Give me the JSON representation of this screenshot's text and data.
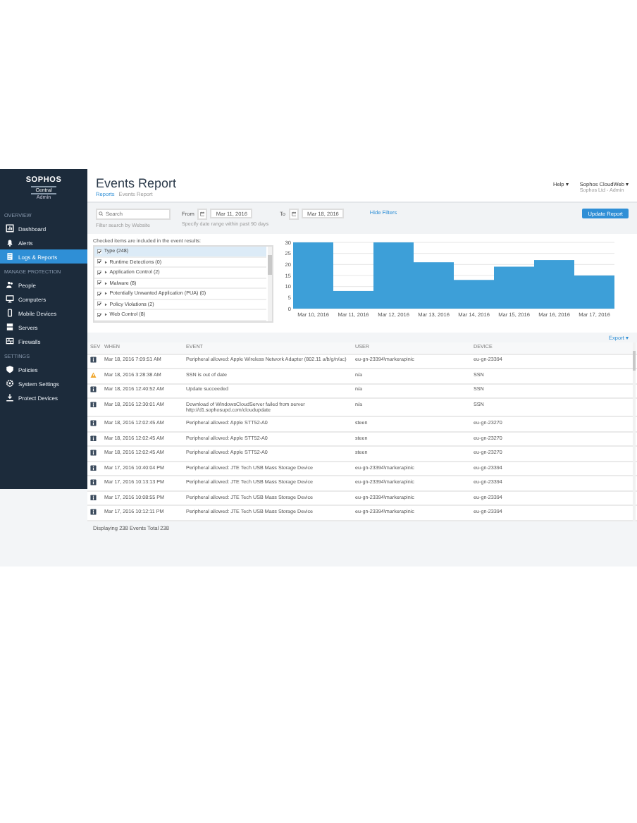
{
  "sidebar": {
    "logo": "SOPHOS",
    "logo_sub": "Central",
    "logo_role": "Admin",
    "sections": [
      {
        "heading": "OVERVIEW",
        "items": [
          {
            "label": "Dashboard",
            "selected": false
          },
          {
            "label": "Alerts",
            "selected": false
          },
          {
            "label": "Logs & Reports",
            "selected": true
          }
        ]
      },
      {
        "heading": "MANAGE PROTECTION",
        "items": [
          {
            "label": "People",
            "selected": false
          },
          {
            "label": "Computers",
            "selected": false
          },
          {
            "label": "Mobile Devices",
            "selected": false
          },
          {
            "label": "Servers",
            "selected": false
          },
          {
            "label": "Firewalls",
            "selected": false
          }
        ]
      },
      {
        "heading": "SETTINGS",
        "items": [
          {
            "label": "Policies",
            "selected": false
          },
          {
            "label": "System Settings",
            "selected": false
          },
          {
            "label": "Protect Devices",
            "selected": false
          }
        ]
      }
    ]
  },
  "header": {
    "title": "Events Report",
    "breadcrumb": [
      "Reports",
      "Events Report"
    ],
    "help": "Help ▾",
    "account": "Sophos CloudWeb ▾",
    "account_sub": "Sophos Ltd - Admin"
  },
  "filters": {
    "search": {
      "placeholder": "Search"
    },
    "search_hint": "Filter search by Website",
    "from_label": "From",
    "from_date": "Mar 11, 2016",
    "range_hint": "Specify date range within past 90 days",
    "to_label": "To",
    "to_date": "Mar 18, 2016",
    "hide": "Hide Filters",
    "update": "Update Report"
  },
  "event_types": {
    "caption": "Checked items are included in the event results:",
    "items": [
      {
        "label": "Type (248)",
        "checked": true,
        "selected": true
      },
      {
        "label": "Runtime Detections (0)",
        "checked": true,
        "selected": false
      },
      {
        "label": "Application Control (2)",
        "checked": true,
        "selected": false
      },
      {
        "label": "Malware (8)",
        "checked": true,
        "selected": false
      },
      {
        "label": "Potentially Unwanted Application (PUA) (0)",
        "checked": true,
        "selected": false
      },
      {
        "label": "Policy Violations (2)",
        "checked": true,
        "selected": false
      },
      {
        "label": "Web Control (8)",
        "checked": true,
        "selected": false
      }
    ]
  },
  "chart_data": {
    "type": "bar",
    "categories": [
      "Mar 10, 2016",
      "Mar 11, 2016",
      "Mar 12, 2016",
      "Mar 13, 2016",
      "Mar 14, 2016",
      "Mar 15, 2016",
      "Mar 16, 2016",
      "Mar 17, 2016"
    ],
    "series": [
      {
        "color": "#3d9fd8",
        "values": [
          30,
          8,
          30,
          21,
          13,
          19,
          22,
          15
        ]
      }
    ],
    "ylim": [
      0,
      30
    ],
    "yticks": [
      0,
      5,
      10,
      15,
      20,
      25,
      30
    ],
    "grid": true
  },
  "export": "Export ▾",
  "table": {
    "columns": [
      "SEV",
      "WHEN",
      "EVENT",
      "USER",
      "DEVICE"
    ],
    "rows": [
      {
        "kind": "info",
        "when": "Mar 18, 2016 7:09:51 AM",
        "event": "Peripheral allowed: Apple Wireless Network Adapter (802.11 a/b/g/n/ac)",
        "user": "eu-gn-23394\\markerapinic",
        "device": "eu-gn-23394"
      },
      {
        "kind": "warning",
        "when": "Mar 18, 2016 3:28:38 AM",
        "event": "SSN is out of date",
        "user": "n/a",
        "device": "SSN"
      },
      {
        "kind": "info",
        "when": "Mar 18, 2016 12:40:52 AM",
        "event": "Update succeeded",
        "user": "n/a",
        "device": "SSN"
      },
      {
        "kind": "info",
        "when": "Mar 18, 2016 12:30:01 AM",
        "event": "Download of WindowsCloudServer failed from server http://d1.sophosupd.com/cloudupdate",
        "user": "n/a",
        "device": "SSN"
      },
      {
        "kind": "info",
        "when": "Mar 18, 2016 12:02:45 AM",
        "event": "Peripheral allowed: Apple STT52-A0",
        "user": "steen",
        "device": "eu-gn-23270"
      },
      {
        "kind": "info",
        "when": "Mar 18, 2016 12:02:45 AM",
        "event": "Peripheral allowed: Apple STT52-A0",
        "user": "steen",
        "device": "eu-gn-23270"
      },
      {
        "kind": "info",
        "when": "Mar 18, 2016 12:02:45 AM",
        "event": "Peripheral allowed: Apple STT52-A0",
        "user": "steen",
        "device": "eu-gn-23270"
      },
      {
        "kind": "info",
        "when": "Mar 17, 2016 10:40:04 PM",
        "event": "Peripheral allowed: JTE Tech USB Mass Storage Device",
        "user": "eu-gn-23394\\markerapinic",
        "device": "eu-gn-23394"
      },
      {
        "kind": "info",
        "when": "Mar 17, 2016 10:13:13 PM",
        "event": "Peripheral allowed: JTE Tech USB Mass Storage Device",
        "user": "eu-gn-23394\\markerapinic",
        "device": "eu-gn-23394"
      },
      {
        "kind": "info",
        "when": "Mar 17, 2016 10:08:55 PM",
        "event": "Peripheral allowed: JTE Tech USB Mass Storage Device",
        "user": "eu-gn-23394\\markerapinic",
        "device": "eu-gn-23394"
      },
      {
        "kind": "info",
        "when": "Mar 17, 2016 10:12:11 PM",
        "event": "Peripheral allowed: JTE Tech USB Mass Storage Device",
        "user": "eu-gn-23394\\markerapinic",
        "device": "eu-gn-23394"
      }
    ]
  },
  "footer": "Displaying 238 Events Total 238"
}
